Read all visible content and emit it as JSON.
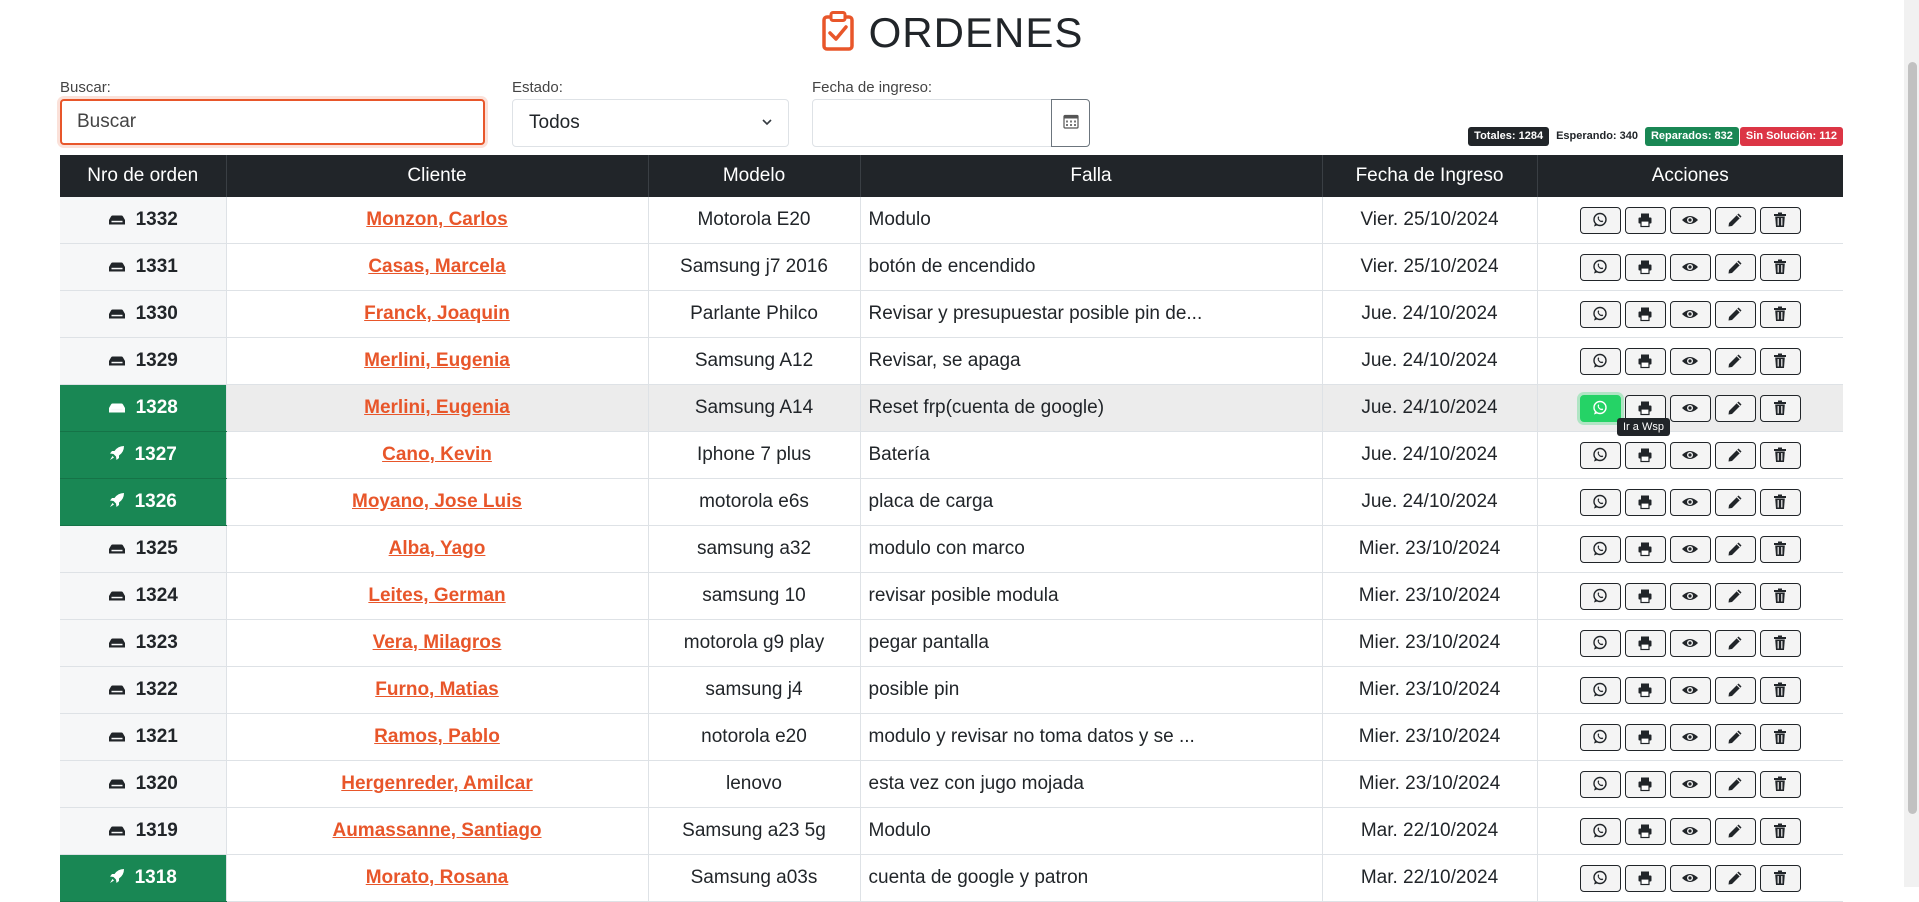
{
  "page": {
    "title": "ORDENES"
  },
  "filters": {
    "search_label": "Buscar:",
    "search_placeholder": "Buscar",
    "status_label": "Estado:",
    "status_value": "Todos",
    "date_label": "Fecha de ingreso:",
    "date_value": ""
  },
  "badges": {
    "total": "Totales: 1284",
    "waiting": "Esperando: 340",
    "fixed": "Reparados: 832",
    "no_solution": "Sin Solución: 112"
  },
  "columns": [
    "Nro de orden",
    "Cliente",
    "Modelo",
    "Falla",
    "Fecha de Ingreso",
    "Acciones"
  ],
  "rows": [
    {
      "nro": "1332",
      "cliente": "Monzon, Carlos",
      "modelo": "Motorola E20",
      "falla": "Modulo",
      "fecha": "Vier. 25/10/2024",
      "estado": "esperando"
    },
    {
      "nro": "1331",
      "cliente": "Casas, Marcela",
      "modelo": "Samsung j7 2016",
      "falla": "botón de encendido",
      "fecha": "Vier. 25/10/2024",
      "estado": "esperando"
    },
    {
      "nro": "1330",
      "cliente": "Franck, Joaquin",
      "modelo": "Parlante Philco",
      "falla": "Revisar y presupuestar posible pin de...",
      "fecha": "Jue. 24/10/2024",
      "estado": "esperando"
    },
    {
      "nro": "1329",
      "cliente": "Merlini, Eugenia",
      "modelo": "Samsung A12",
      "falla": "Revisar, se apaga",
      "fecha": "Jue. 24/10/2024",
      "estado": "esperando"
    },
    {
      "nro": "1328",
      "cliente": "Merlini, Eugenia",
      "modelo": "Samsung A14",
      "falla": "Reset frp(cuenta de google)",
      "fecha": "Jue. 24/10/2024",
      "estado": "esperando",
      "green": true,
      "highlight": true
    },
    {
      "nro": "1327",
      "cliente": "Cano, Kevin",
      "modelo": "Iphone 7 plus",
      "falla": "Batería",
      "fecha": "Jue. 24/10/2024",
      "estado": "reparado",
      "green": true
    },
    {
      "nro": "1326",
      "cliente": "Moyano, Jose Luis",
      "modelo": "motorola e6s",
      "falla": "placa de carga",
      "fecha": "Jue. 24/10/2024",
      "estado": "reparado",
      "green": true
    },
    {
      "nro": "1325",
      "cliente": "Alba, Yago",
      "modelo": "samsung a32",
      "falla": "modulo con marco",
      "fecha": "Mier. 23/10/2024",
      "estado": "esperando"
    },
    {
      "nro": "1324",
      "cliente": "Leites, German",
      "modelo": "samsung 10",
      "falla": "revisar posible modula",
      "fecha": "Mier. 23/10/2024",
      "estado": "esperando"
    },
    {
      "nro": "1323",
      "cliente": "Vera, Milagros",
      "modelo": "motorola g9 play",
      "falla": "pegar pantalla",
      "fecha": "Mier. 23/10/2024",
      "estado": "esperando"
    },
    {
      "nro": "1322",
      "cliente": "Furno, Matias",
      "modelo": "samsung j4",
      "falla": "posible pin",
      "fecha": "Mier. 23/10/2024",
      "estado": "esperando"
    },
    {
      "nro": "1321",
      "cliente": "Ramos, Pablo",
      "modelo": "notorola e20",
      "falla": "modulo y revisar no toma datos y se ...",
      "fecha": "Mier. 23/10/2024",
      "estado": "esperando"
    },
    {
      "nro": "1320",
      "cliente": "Hergenreder, Amilcar",
      "modelo": "lenovo",
      "falla": "esta vez con jugo mojada",
      "fecha": "Mier. 23/10/2024",
      "estado": "esperando"
    },
    {
      "nro": "1319",
      "cliente": "Aumassanne, Santiago",
      "modelo": "Samsung a23 5g",
      "falla": "Modulo",
      "fecha": "Mar. 22/10/2024",
      "estado": "esperando"
    },
    {
      "nro": "1318",
      "cliente": "Morato, Rosana",
      "modelo": "Samsung a03s",
      "falla": "cuenta de google y patron",
      "fecha": "Mar. 22/10/2024",
      "estado": "reparado",
      "green": true
    }
  ],
  "tooltip": "Ir a Wsp",
  "colors": {
    "accent": "#e8562a",
    "header": "#212529",
    "success": "#198754",
    "danger": "#dc3545",
    "whatsapp": "#25d366"
  }
}
